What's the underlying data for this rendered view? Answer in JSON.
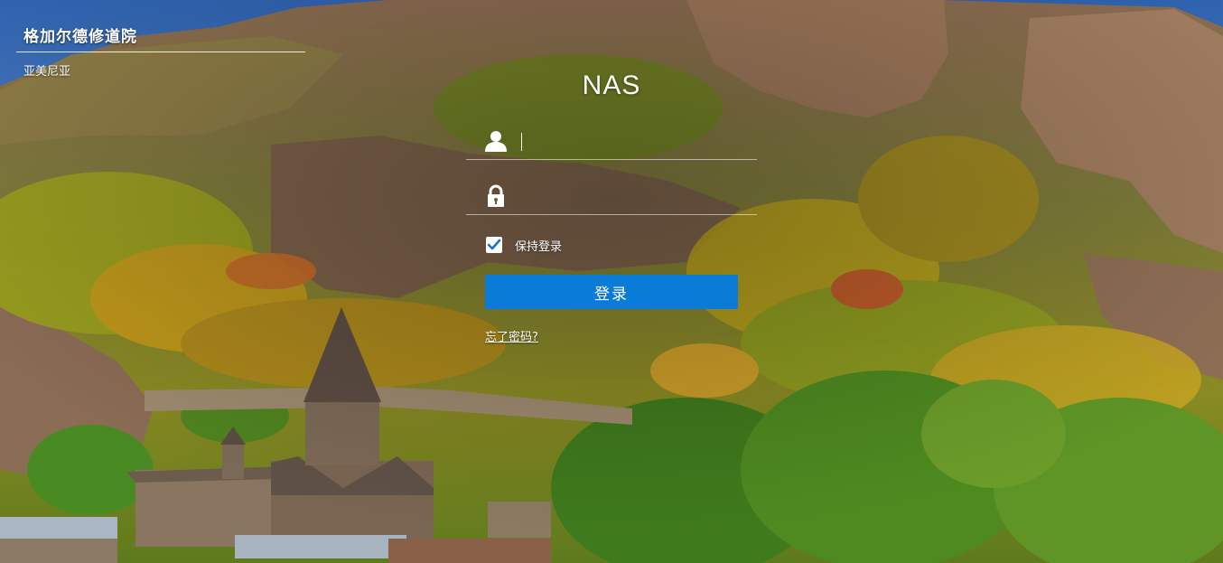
{
  "location": {
    "title": "格加尔德修道院",
    "country": "亚美尼亚"
  },
  "login": {
    "app_name": "NAS",
    "username": {
      "value": "",
      "icon": "user-icon"
    },
    "password": {
      "value": "",
      "icon": "lock-icon"
    },
    "remember_me": {
      "label": "保持登录",
      "checked": true
    },
    "submit_label": "登录",
    "forgot_password_label": "忘了密码?"
  },
  "colors": {
    "button": "#0b7bd8",
    "checkmark": "#1a73c8",
    "text": "#ffffff"
  }
}
